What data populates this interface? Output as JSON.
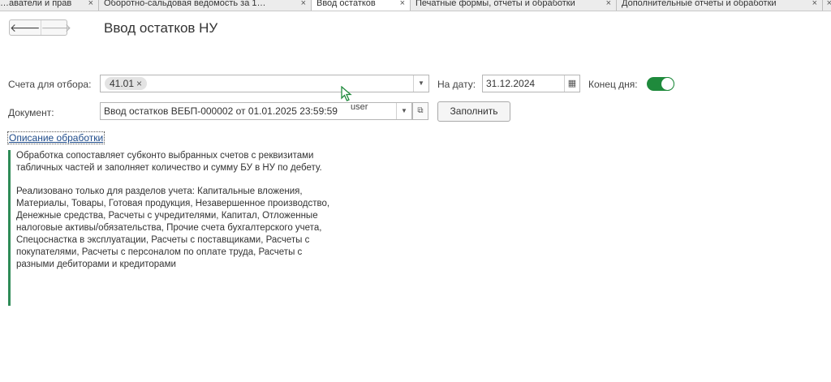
{
  "tabs": [
    {
      "label": "…аватели и прав",
      "close": "×"
    },
    {
      "label": "Оборотно-сальдовая ведомость за 1…",
      "close": "×"
    },
    {
      "label": "Ввод остатков",
      "close": "×"
    },
    {
      "label": "Печатные формы, отчеты и обработки",
      "close": "×"
    },
    {
      "label": "Дополнительные отчеты и обработки",
      "close": "×"
    },
    {
      "label": "",
      "close": "×"
    }
  ],
  "header": {
    "back_glyph": "🡐",
    "forward_glyph": "🡒",
    "title": "Ввод остатков НУ"
  },
  "form": {
    "accounts_label": "Счета для отбора:",
    "accounts_chip": "41.01",
    "chip_remove": "×",
    "date_label": "На дату:",
    "date_value": "31.12.2024",
    "end_of_day_label": "Конец дня:",
    "end_of_day_on": true,
    "document_label": "Документ:",
    "document_value": "Ввод остатков ВЕБП-000002 от 01.01.2025 23:59:59",
    "fill_button": "Заполнить"
  },
  "overlay": {
    "user_text": "user"
  },
  "description": {
    "link": "Описание обработки",
    "paragraph1": "Обработка сопоставляет субконто выбранных счетов с реквизитами табличных частей и заполняет количество и сумму БУ в НУ по дебету.",
    "paragraph2": "Реализовано только для разделов учета: Капитальные вложения, Материалы, Товары, Готовая продукция, Незавершенное производство, Денежные средства, Расчеты с учредителями, Капитал, Отложенные налоговые активы/обязательства, Прочие счета бухгалтерского учета, Спецоснастка в эксплуатации, Расчеты с поставщиками, Расчеты с покупателями, Расчеты с персоналом по оплате труда, Расчеты с разными дебиторами и кредиторами"
  },
  "icons": {
    "dropdown": "▼",
    "calendar": "▦",
    "open": "⧉"
  },
  "colors": {
    "toggle_on": "#1f8a3c",
    "description_bar": "#2e8b57",
    "link": "#1e4b8a"
  }
}
